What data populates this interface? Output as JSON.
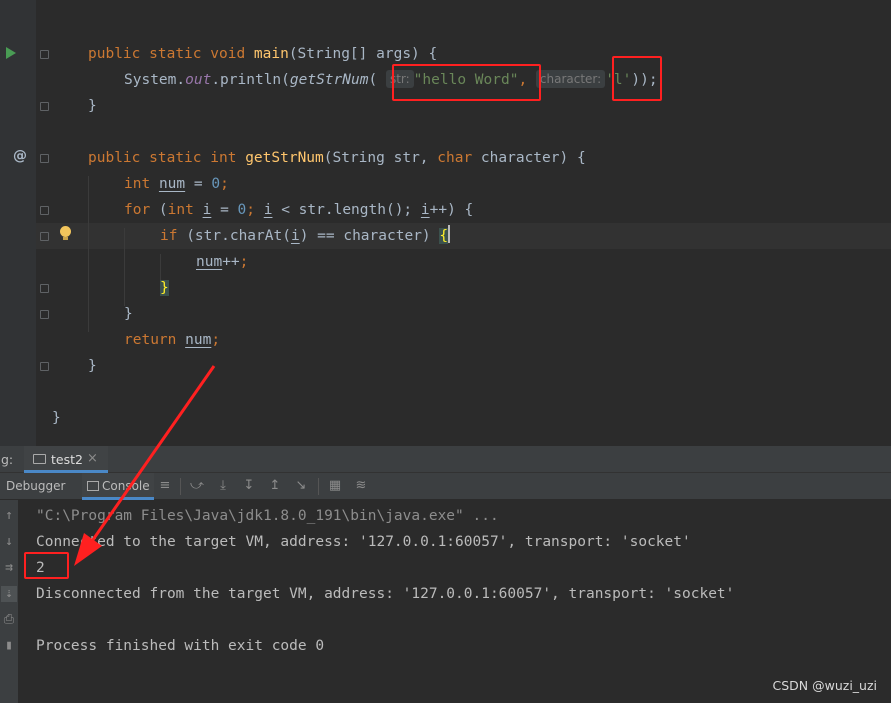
{
  "editor": {
    "code": {
      "main_sig": {
        "kw1": "public",
        "kw2": "static",
        "kw3": "void",
        "name": "main",
        "params": "(String[] args) {"
      },
      "println_line": {
        "prefix": "System.",
        "out": "out",
        "println": ".println(",
        "call": "getStrNum",
        "paren": "(",
        "hint1": "str:",
        "arg1": "\"hello Word\"",
        "comma": ",",
        "hint2": "character:",
        "arg2": "'l'",
        "suffix": "));"
      },
      "close1": "}",
      "method_sig": {
        "kw1": "public",
        "kw2": "static",
        "kw3": "int",
        "name": "getStrNum",
        "p1": "(String str, ",
        "kw4": "char",
        "p2": " character) {"
      },
      "decl": {
        "kw": "int",
        "var": "num",
        "rest": " = ",
        "num": "0",
        "semi": ";"
      },
      "for_line": {
        "kw": "for",
        "open": " (",
        "kw2": "int",
        "var": "i",
        "mid": " = ",
        "zero": "0",
        "semi1": "; ",
        "var2": "i",
        "cond": " < str.length(); ",
        "var3": "i",
        "end": "++) {"
      },
      "if_line": {
        "kw": "if",
        "open": " (str.charAt(",
        "var": "i",
        "cond": ") == character) ",
        "brace": "{"
      },
      "inc": {
        "var": "num",
        "rest": "++",
        "semi": ";"
      },
      "brace_close_if": "}",
      "brace_close_for": "}",
      "ret": {
        "kw": "return",
        "space": " ",
        "var": "num",
        "semi": ";"
      },
      "close_method": "}",
      "close_class": "}"
    }
  },
  "tool": {
    "label_prefix": "g:",
    "run_tab": "test2",
    "close_glyph": "×",
    "tabs": [
      "Debugger",
      "Console"
    ],
    "console_lines": {
      "cmd": "\"C:\\Program Files\\Java\\jdk1.8.0_191\\bin\\java.exe\" ...",
      "connected": "Connected to the target VM, address: '127.0.0.1:60057', transport: 'socket'",
      "output": "2",
      "disconnected": "Disconnected from the target VM, address: '127.0.0.1:60057', transport: 'socket'",
      "finished": "Process finished with exit code 0"
    }
  },
  "watermark": "CSDN @wuzi_uzi",
  "colors": {
    "annotation": "#ff2020",
    "keyword": "#cc7832",
    "string": "#6a8759",
    "function": "#ffc66d"
  }
}
